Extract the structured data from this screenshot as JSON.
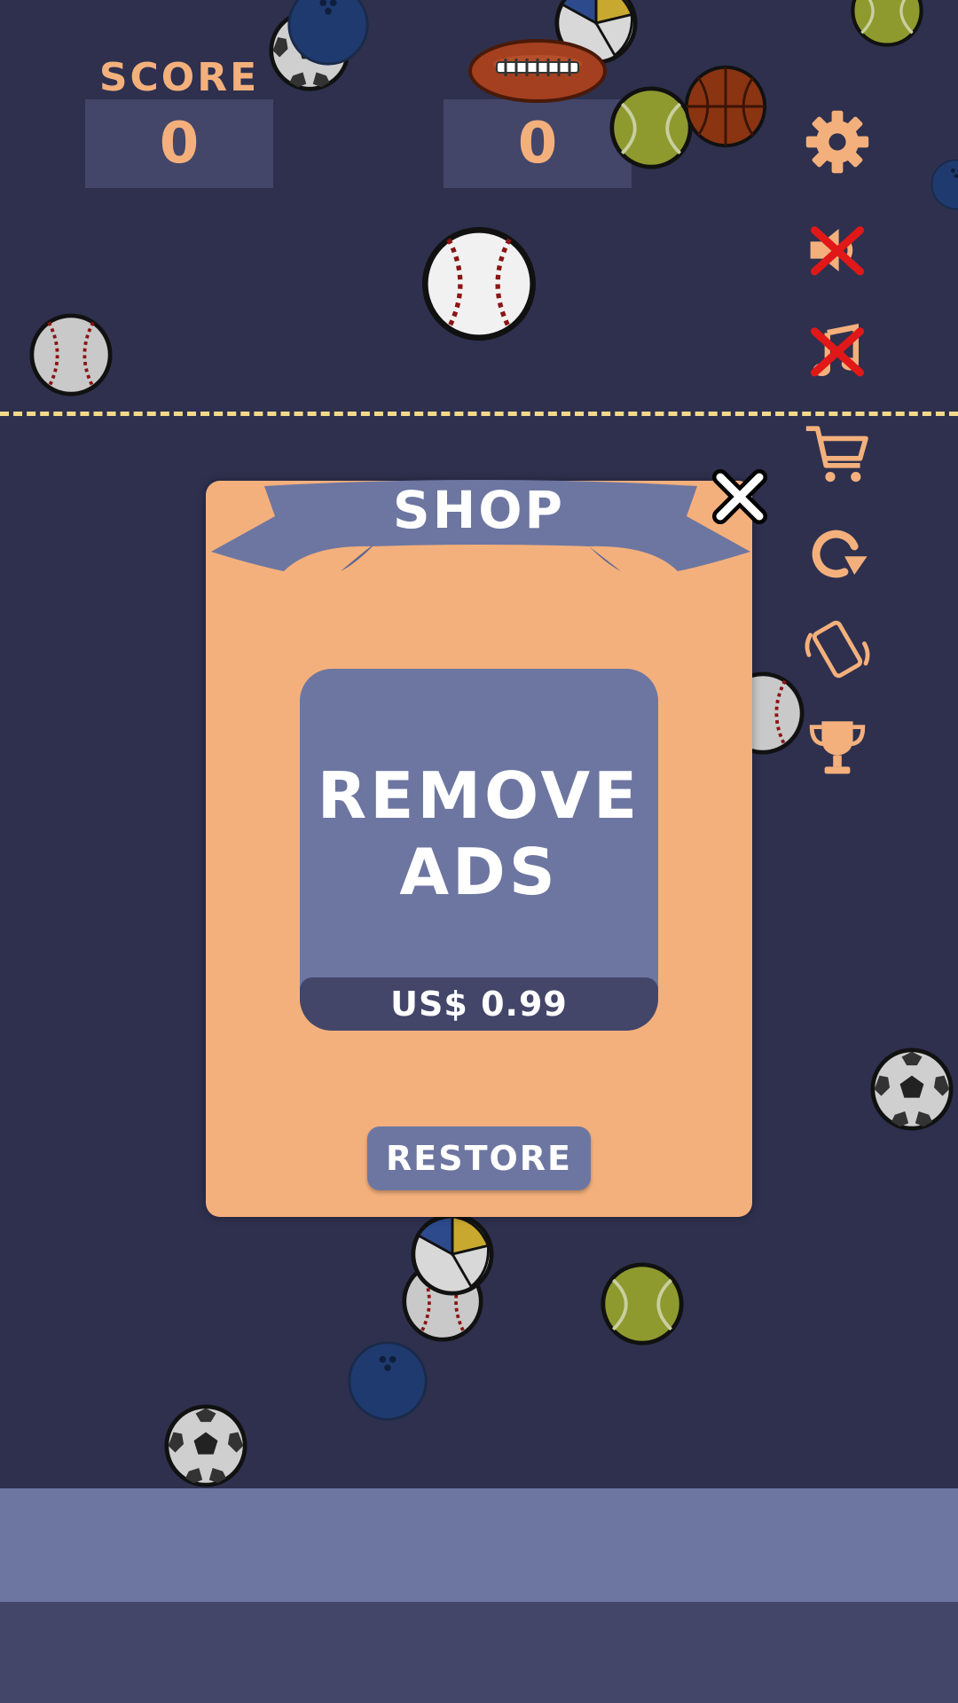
{
  "score": {
    "label": "SCORE",
    "current": "0",
    "best": "0"
  },
  "sidebar": {
    "items": [
      {
        "icon": "gear-icon"
      },
      {
        "icon": "sound-muted-icon"
      },
      {
        "icon": "music-muted-icon"
      },
      {
        "icon": "cart-icon"
      },
      {
        "icon": "restart-icon"
      },
      {
        "icon": "vibration-icon"
      },
      {
        "icon": "trophy-icon"
      }
    ]
  },
  "shop": {
    "title": "SHOP",
    "item": {
      "title_line1": "REMOVE",
      "title_line2": "ADS",
      "price": "US$ 0.99"
    },
    "restore_label": "RESTORE"
  },
  "colors": {
    "background": "#2e304e",
    "accent": "#f4b07c",
    "panel_blue": "#6d76a1",
    "dark_box": "#434669",
    "dash_line": "#f3d98a"
  }
}
